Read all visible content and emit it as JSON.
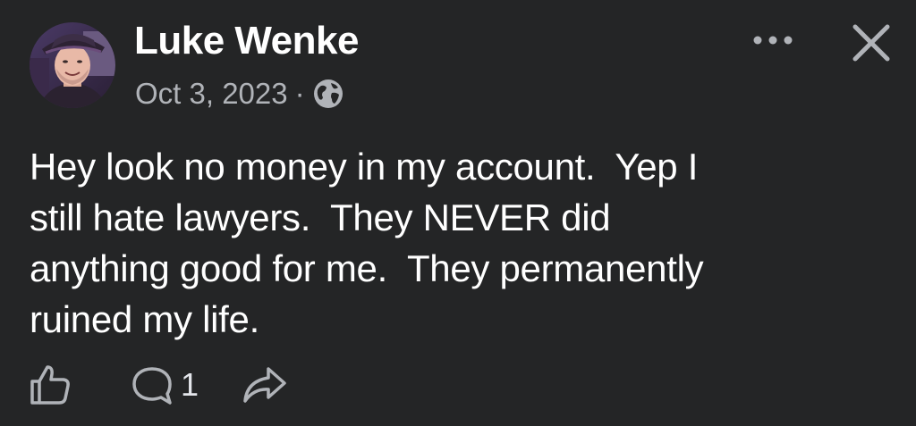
{
  "post": {
    "author": "Luke Wenke",
    "date": "Oct 3, 2023",
    "separator": "·",
    "privacy_icon": "globe-icon",
    "text": "Hey look no money in my account.  Yep I\nstill hate lawyers.  They NEVER did\nanything good for me.  They permanently\nruined my life.",
    "comment_count": "1"
  },
  "icons": {
    "more": "more-horizontal-icon",
    "close": "close-icon",
    "like": "thumbs-up-icon",
    "comment": "comment-icon",
    "share": "share-icon"
  },
  "colors": {
    "background": "#242526",
    "primary_text": "#ffffff",
    "secondary_text": "#b0b3b8"
  }
}
